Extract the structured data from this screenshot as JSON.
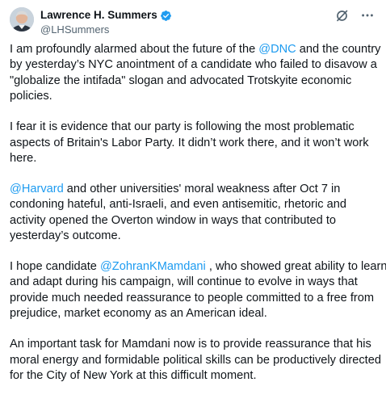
{
  "author": {
    "name": "Lawrence H. Summers",
    "handle": "@LHSummers",
    "verified_color": "#1d9bf0"
  },
  "header_actions": [
    {
      "icon": "grok-slash-icon"
    },
    {
      "icon": "more-horizontal-icon"
    }
  ],
  "colors": {
    "link": "#1d9bf0",
    "secondary": "#536471",
    "text": "#0f1419"
  },
  "paragraphs": [
    {
      "lines": [
        {
          "before": "I am profoundly alarmed about the future of the ",
          "mention": "@DNC",
          "after": "  and the country"
        },
        {
          "text": "by yesterday’s NYC anointment of a candidate who failed to disavow a"
        },
        {
          "text": "\"globalize the intifada\" slogan and advocated Trotskyite economic"
        },
        {
          "text": "policies."
        }
      ]
    },
    {
      "lines": [
        {
          "text": "I fear it is evidence that our party is following the most problematic"
        },
        {
          "text": "aspects of Britain's Labor Party. It didn’t work there, and it won’t work"
        },
        {
          "text": "here."
        }
      ]
    },
    {
      "lines": [
        {
          "before": "",
          "mention": "@Harvard",
          "after": " and other universities' moral weakness after Oct 7 in"
        },
        {
          "text": "condoning hateful, anti-Israeli, and even antisemitic, rhetoric and"
        },
        {
          "text": "activity opened the Overton window in ways that contributed to"
        },
        {
          "text": "yesterday’s outcome."
        }
      ]
    },
    {
      "lines": [
        {
          "before": "I hope candidate ",
          "mention": "@ZohranKMamdani",
          "after": " , who showed great ability to learn"
        },
        {
          "text": "and adapt during his campaign, will continue to evolve in ways that"
        },
        {
          "text": "provide much needed reassurance to people committed to a free from"
        },
        {
          "text": "prejudice, market economy as an American ideal."
        }
      ]
    },
    {
      "lines": [
        {
          "text": "An important task for Mamdani now is to provide reassurance that his"
        },
        {
          "text": "moral energy and formidable political skills can be productively directed"
        },
        {
          "text": "for the City of New York at this difficult moment."
        }
      ]
    }
  ]
}
